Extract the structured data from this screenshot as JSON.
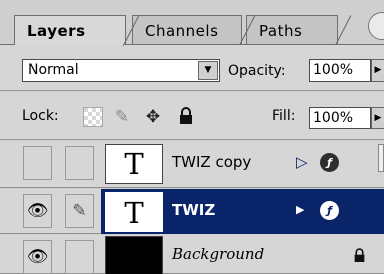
{
  "tabs": [
    {
      "label": "Layers",
      "active": true
    },
    {
      "label": "Channels",
      "active": false
    },
    {
      "label": "Paths",
      "active": false
    }
  ],
  "blend": {
    "value": "Normal",
    "arrow": "▼"
  },
  "opacity": {
    "label": "Opacity:",
    "value": "100%",
    "arrow": "▶"
  },
  "lock": {
    "label": "Lock:",
    "icons": [
      "transparency-lock-icon",
      "paint-brush-lock-icon",
      "move-lock-icon",
      "padlock-icon"
    ]
  },
  "fill": {
    "label": "Fill:",
    "value": "100%",
    "arrow": "▶"
  },
  "layers": [
    {
      "name": "TWIZ copy",
      "thumb": "T",
      "visible": false,
      "selected": false,
      "fx_icon": "ƒ",
      "expand": "▷"
    },
    {
      "name": "TWIZ",
      "thumb": "T",
      "visible": true,
      "selected": true,
      "fx_icon": "ƒ",
      "expand": "▶"
    },
    {
      "name": "Background",
      "thumb": "",
      "visible": true,
      "selected": false,
      "locked": true
    }
  ],
  "colors": {
    "selection": "#0a246a",
    "panel": "#d6d6d6"
  }
}
